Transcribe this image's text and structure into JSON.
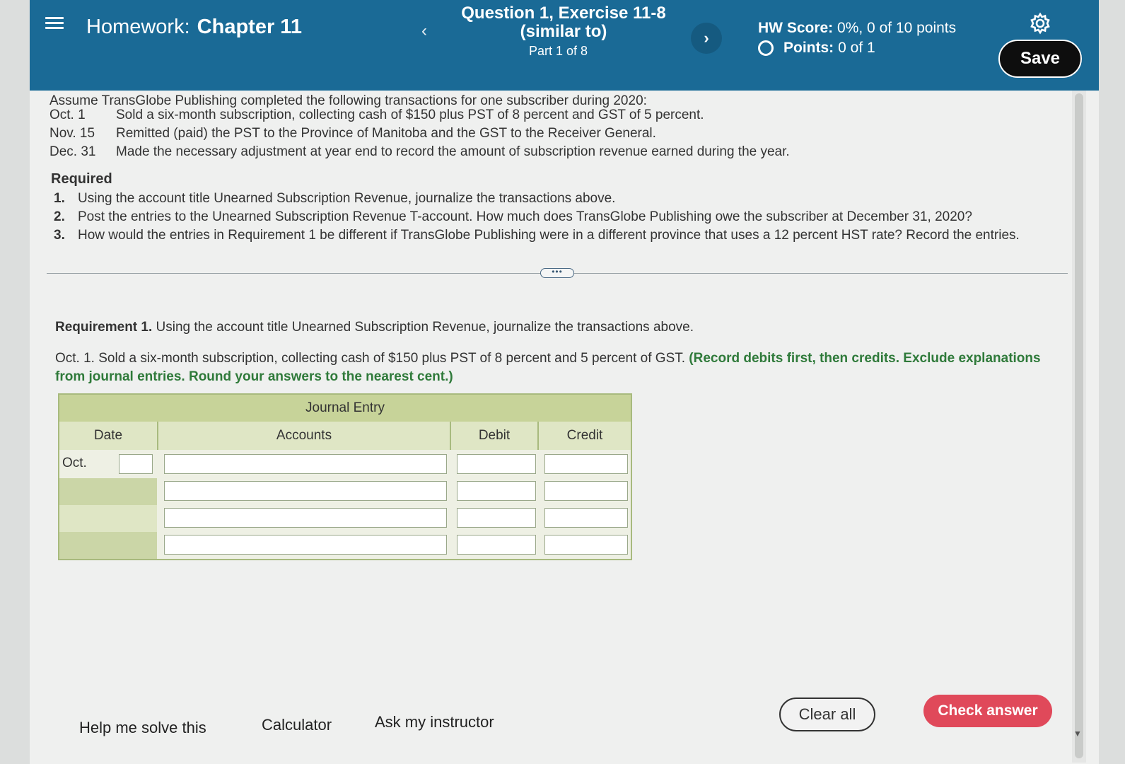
{
  "header": {
    "title_prefix": "Homework:",
    "title_main": "Chapter 11",
    "question_line1": "Question 1, Exercise 11-8",
    "question_line2": "(similar to)",
    "part": "Part 1 of 8",
    "prev_label": "‹",
    "next_label": "›",
    "score_label": "HW Score:",
    "score_value": "0%, 0 of 10 points",
    "points_label": "Points:",
    "points_value": "0 of 1",
    "save_label": "Save"
  },
  "problem": {
    "intro": "Assume TransGlobe Publishing completed the following transactions for one subscriber during 2020:",
    "transactions": [
      {
        "date": "Oct. 1",
        "text": "Sold a six-month subscription, collecting cash of $150 plus PST of 8 percent and GST of 5 percent."
      },
      {
        "date": "Nov. 15",
        "text": "Remitted (paid) the PST to the Province of Manitoba and the GST to the Receiver General."
      },
      {
        "date": "Dec. 31",
        "text": "Made the necessary adjustment at year end to record the amount of subscription revenue earned during the year."
      }
    ],
    "required_heading": "Required",
    "requirements": [
      {
        "num": "1.",
        "text": "Using the account title Unearned Subscription Revenue, journalize the transactions above."
      },
      {
        "num": "2.",
        "text": "Post the entries to the Unearned Subscription Revenue T-account. How much does TransGlobe Publishing owe the subscriber at December 31, 2020?"
      },
      {
        "num": "3.",
        "text": "How would the entries in Requirement 1 be different if TransGlobe Publishing were in a different province that uses a 12 percent HST rate? Record the entries."
      }
    ],
    "expand_label": "•••"
  },
  "current": {
    "req_label": "Requirement 1.",
    "req_text": "Using the account title Unearned Subscription Revenue, journalize the transactions above.",
    "instruction_plain": "Oct. 1. Sold a six-month subscription, collecting cash of $150 plus PST of 8 percent and 5 percent of GST. ",
    "instruction_green": "(Record debits first, then credits. Exclude explanations from journal entries. Round your answers to the nearest cent.)"
  },
  "journal": {
    "title": "Journal Entry",
    "columns": [
      "Date",
      "Accounts",
      "Debit",
      "Credit"
    ],
    "month_label": "Oct.",
    "rows": [
      {
        "day": "",
        "account": "",
        "debit": "",
        "credit": ""
      },
      {
        "account": "",
        "debit": "",
        "credit": ""
      },
      {
        "account": "",
        "debit": "",
        "credit": ""
      },
      {
        "account": "",
        "debit": "",
        "credit": ""
      }
    ]
  },
  "footer": {
    "help_label": "Help me solve this",
    "calculator_label": "Calculator",
    "instructor_label": "Ask my instructor",
    "clear_label": "Clear all",
    "check_label": "Check answer"
  },
  "colors": {
    "header_bg": "#1a6a96",
    "check_btn": "#e0495a",
    "instruction_green": "#2f7a3a",
    "table_header": "#c7d399"
  },
  "icons": {
    "menu": "hamburger-menu-icon",
    "settings": "gear-icon",
    "points": "empty-circle-icon"
  }
}
